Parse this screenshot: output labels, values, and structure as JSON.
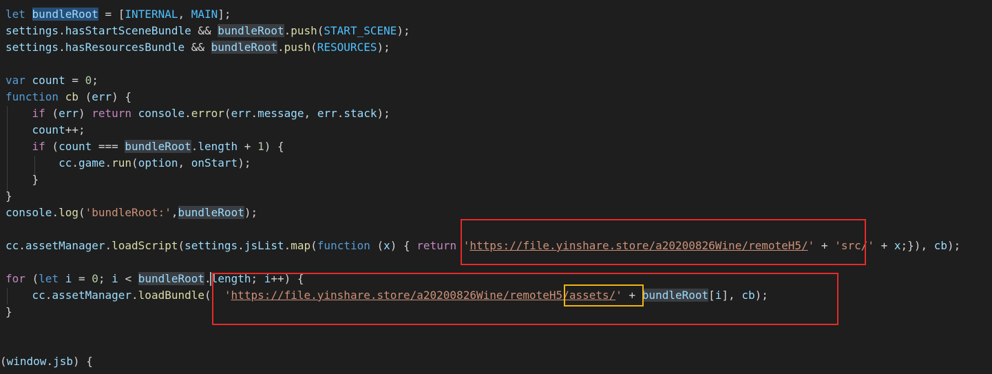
{
  "editor": {
    "lines": {
      "l1": {
        "kw_let": "let",
        "var_bundleRoot": "bundleRoot",
        "p1": " = [",
        "c_internal": "INTERNAL",
        "p2": ", ",
        "c_main": "MAIN",
        "p3": "];"
      },
      "l2": {
        "v_settings": "settings",
        "p1": ".",
        "v_prop": "hasStartSceneBundle",
        "p2": " && ",
        "v_br": "bundleRoot",
        "p3": ".",
        "f_push": "push",
        "p4": "(",
        "c_start": "START_SCENE",
        "p5": ");"
      },
      "l3": {
        "v_settings": "settings",
        "p1": ".",
        "v_prop": "hasResourcesBundle",
        "p2": " && ",
        "v_br": "bundleRoot",
        "p3": ".",
        "f_push": "push",
        "p4": "(",
        "c_res": "RESOURCES",
        "p5": ");"
      },
      "l5": {
        "kw_var": "var",
        "sp": " ",
        "v_count": "count",
        "p1": " = ",
        "n0": "0",
        "p2": ";"
      },
      "l6": {
        "kw_function": "function",
        "sp": " ",
        "f_cb": "cb",
        "p1": " (",
        "v_err": "err",
        "p2": ") {"
      },
      "l7": {
        "ind": "    ",
        "ctl_if": "if",
        "p1": " (",
        "v_err": "err",
        "p2": ") ",
        "ctl_return": "return",
        "sp": " ",
        "v_console": "console",
        "p3": ".",
        "f_error": "error",
        "p4": "(",
        "v_err2": "err",
        "p5": ".",
        "v_message": "message",
        "p6": ", ",
        "v_err3": "err",
        "p7": ".",
        "v_stack": "stack",
        "p8": ");"
      },
      "l8": {
        "ind": "    ",
        "v_count": "count",
        "p1": "++;"
      },
      "l9": {
        "ind": "    ",
        "ctl_if": "if",
        "p1": " (",
        "v_count": "count",
        "p2": " === ",
        "v_br": "bundleRoot",
        "p3": ".",
        "v_length": "length",
        "p4": " + ",
        "n1": "1",
        "p5": ") {"
      },
      "l10": {
        "ind": "        ",
        "v_cc": "cc",
        "p1": ".",
        "v_game": "game",
        "p2": ".",
        "f_run": "run",
        "p3": "(",
        "v_option": "option",
        "p4": ", ",
        "v_onstart": "onStart",
        "p5": ");"
      },
      "l11": {
        "ind": "    ",
        "p1": "}"
      },
      "l12": {
        "p1": "}"
      },
      "l13": {
        "v_console": "console",
        "p1": ".",
        "f_log": "log",
        "p2": "(",
        "s1": "'bundleRoot:'",
        "p3": ",",
        "v_br": "bundleRoot",
        "p4": ");"
      },
      "l15": {
        "v_cc": "cc",
        "p1": ".",
        "v_am": "assetManager",
        "p2": ".",
        "f_ls": "loadScript",
        "p3": "(",
        "v_settings": "settings",
        "p4": ".",
        "v_jslist": "jsList",
        "p5": ".",
        "f_map": "map",
        "p6": "(",
        "kw_function": "function",
        "p7": " (",
        "v_x": "x",
        "p8": ") { ",
        "ctl_return": "return",
        "sp": " ",
        "q1": "'",
        "url1": "https://file.yinshare.store/a20200826Wine/remoteH5/",
        "q2": "'",
        "p9": " + ",
        "s2": "'src/'",
        "p10": " + ",
        "v_x2": "x",
        "p11": ";}), ",
        "v_cb": "cb",
        "p12": ");"
      },
      "l17": {
        "ctl_for": "for",
        "p1": " (",
        "kw_let": "let",
        "sp": " ",
        "v_i": "i",
        "p2": " = ",
        "n0": "0",
        "p3": "; ",
        "v_i2": "i",
        "p4": " < ",
        "v_br": "bundleRoot",
        "p5": ".",
        "v_length": "length",
        "p6": "; ",
        "v_i3": "i",
        "p7": "++) {"
      },
      "l18": {
        "ind": "    ",
        "v_cc": "cc",
        "p1": ".",
        "v_am": "assetManager",
        "p2": ".",
        "f_lb": "loadBundle",
        "p3": "(  ",
        "q1": "'",
        "url2": "https://file.yinshare.store/a20200826Wine/remoteH5/assets/",
        "q2": "'",
        "p4": " + ",
        "v_br": "bundleRoot",
        "p5": "[",
        "v_i": "i",
        "p6": "], ",
        "v_cb": "cb",
        "p7": ");"
      },
      "l19": {
        "p1": "}"
      },
      "l22": {
        "p1": "(",
        "v_window": "window",
        "p2": ".",
        "v_jsb": "jsb",
        "p3": ") {"
      }
    }
  },
  "colors": {
    "background": "#1e1e1e",
    "keyword": "#569cd6",
    "control": "#c586c0",
    "function": "#dcdcaa",
    "variable": "#9cdcfe",
    "constant": "#4fc1ff",
    "number": "#b5cea8",
    "string": "#ce9178",
    "annotation_red": "#e82a2a",
    "annotation_yellow": "#f2b50f"
  }
}
